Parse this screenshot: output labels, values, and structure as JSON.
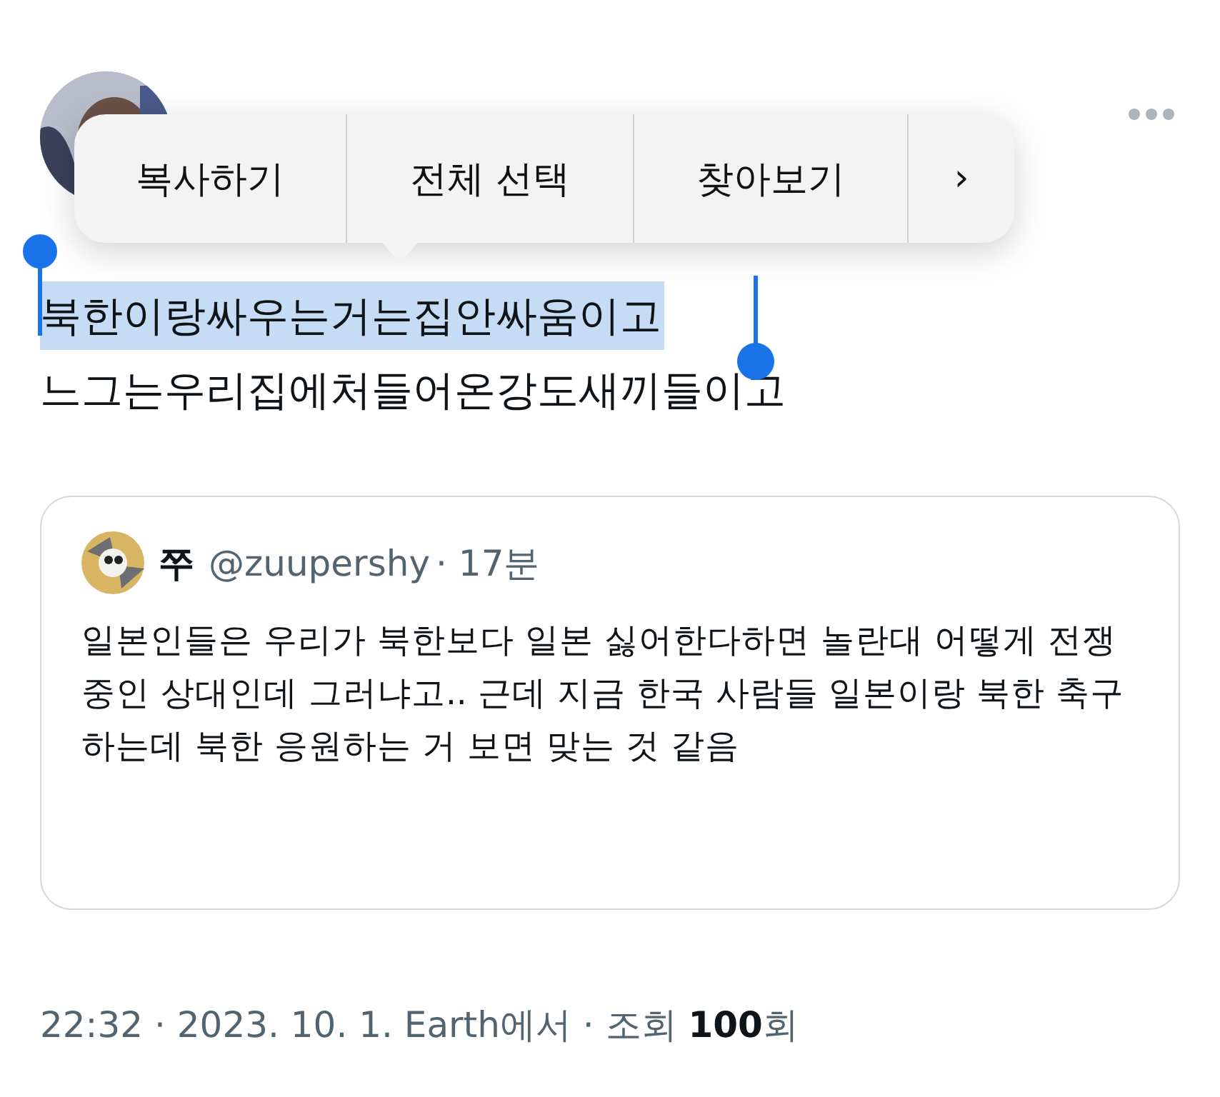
{
  "context_menu": {
    "items": [
      {
        "label": "복사하기"
      },
      {
        "label": "전체 선택"
      },
      {
        "label": "찾아보기"
      },
      {
        "label": "›"
      }
    ]
  },
  "post": {
    "lines": [
      {
        "text": "북한이랑싸우는거는집안싸움이고",
        "selected": true
      },
      {
        "text": "느그는우리집에처들어온강도새끼들이고",
        "selected": false
      }
    ]
  },
  "quote": {
    "name": "쭈",
    "handle": "@zuupershy",
    "time": "· 17분",
    "text": "일본인들은 우리가 북한보다 일본 싫어한다하면 놀란대 어떻게 전쟁 중인 상대인데 그러냐고.. 근데 지금 한국 사람들 일본이랑 북한 축구하는데 북한 응원하는 거 보면 맞는 것 같음"
  },
  "meta": {
    "text": "22:32 · 2023. 10. 1. Earth에서 · 조회 **100**회"
  }
}
